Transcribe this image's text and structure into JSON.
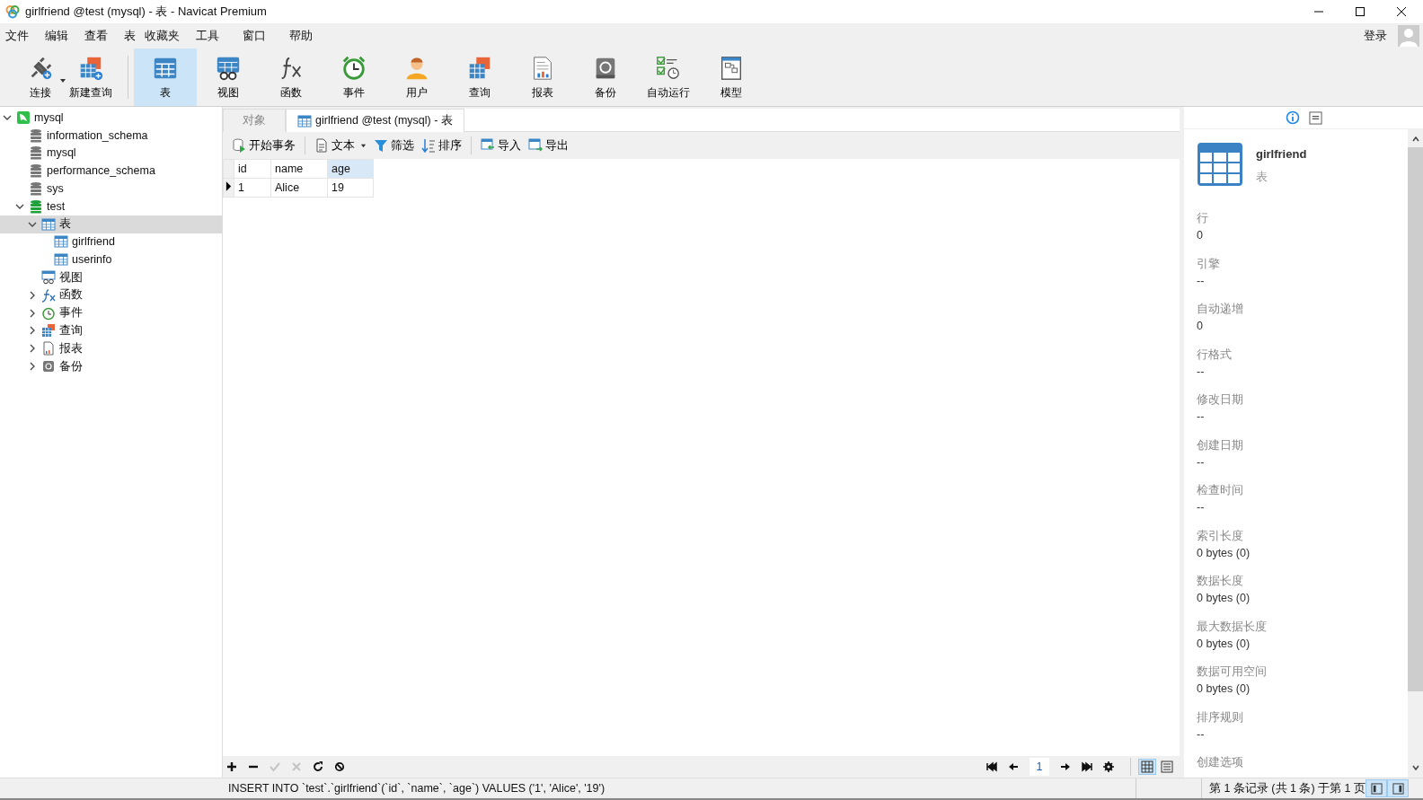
{
  "window": {
    "title": "girlfriend @test (mysql) - 表 - Navicat Premium"
  },
  "menu": [
    "文件",
    "编辑",
    "查看",
    "表",
    "收藏夹",
    "工具",
    "窗口",
    "帮助"
  ],
  "login": "登录",
  "toolbar": [
    {
      "kind": "connect",
      "label": "连接",
      "selected": false
    },
    {
      "kind": "new-query",
      "label": "新建查询",
      "selected": false
    },
    {
      "kind": "table",
      "label": "表",
      "selected": true
    },
    {
      "kind": "view",
      "label": "视图",
      "selected": false
    },
    {
      "kind": "function",
      "label": "函数",
      "selected": false
    },
    {
      "kind": "event",
      "label": "事件",
      "selected": false
    },
    {
      "kind": "user",
      "label": "用户",
      "selected": false
    },
    {
      "kind": "query",
      "label": "查询",
      "selected": false
    },
    {
      "kind": "report",
      "label": "报表",
      "selected": false
    },
    {
      "kind": "backup",
      "label": "备份",
      "selected": false
    },
    {
      "kind": "autorun",
      "label": "自动运行",
      "selected": false
    },
    {
      "kind": "model",
      "label": "模型",
      "selected": false
    }
  ],
  "tree": [
    {
      "kind": "server",
      "label": "mysql",
      "expanded": true,
      "selected": false,
      "children": [
        {
          "kind": "database",
          "label": "information_schema",
          "open": false,
          "selected": false
        },
        {
          "kind": "database",
          "label": "mysql",
          "open": false,
          "selected": false
        },
        {
          "kind": "database",
          "label": "performance_schema",
          "open": false,
          "selected": false
        },
        {
          "kind": "database",
          "label": "sys",
          "open": false,
          "selected": false
        },
        {
          "kind": "database",
          "label": "test",
          "open": true,
          "expanded": true,
          "selected": false,
          "children": [
            {
              "kind": "table",
              "label": "表",
              "expanded": true,
              "selected": true,
              "children": [
                {
                  "kind": "table",
                  "label": "girlfriend",
                  "selected": false
                },
                {
                  "kind": "table",
                  "label": "userinfo",
                  "selected": false
                }
              ]
            },
            {
              "kind": "view",
              "label": "视图",
              "selected": false
            },
            {
              "kind": "function",
              "label": "函数",
              "expanded": false,
              "selected": false
            },
            {
              "kind": "event",
              "label": "事件",
              "expanded": false,
              "selected": false
            },
            {
              "kind": "query",
              "label": "查询",
              "expanded": false,
              "selected": false
            },
            {
              "kind": "report",
              "label": "报表",
              "expanded": false,
              "selected": false
            },
            {
              "kind": "backup",
              "label": "备份",
              "expanded": false,
              "selected": false
            }
          ]
        }
      ]
    }
  ],
  "tabs": [
    {
      "kind": "objects",
      "label": "对象",
      "selected": false
    },
    {
      "kind": "table",
      "label": "girlfriend @test (mysql) - 表",
      "selected": true
    }
  ],
  "data_toolbar": [
    {
      "kind": "transaction",
      "label": "开始事务"
    },
    {
      "kind": "text",
      "label": "文本"
    },
    {
      "kind": "filter",
      "label": "筛选"
    },
    {
      "kind": "sort",
      "label": "排序"
    },
    {
      "kind": "import",
      "label": "导入"
    },
    {
      "kind": "export",
      "label": "导出"
    }
  ],
  "grid": {
    "columns": [
      {
        "label": "id",
        "selected": false
      },
      {
        "label": "name",
        "selected": false
      },
      {
        "label": "age",
        "selected": true
      }
    ],
    "rows": [
      {
        "current": true,
        "cells": [
          "1",
          "Alice",
          "19"
        ]
      }
    ]
  },
  "grid_actions": [
    {
      "kind": "add",
      "disabled": false
    },
    {
      "kind": "remove",
      "disabled": false
    },
    {
      "kind": "apply",
      "disabled": true
    },
    {
      "kind": "cancel",
      "disabled": true
    },
    {
      "kind": "refresh",
      "disabled": false
    },
    {
      "kind": "stop",
      "disabled": false
    }
  ],
  "pager": {
    "page": "1"
  },
  "view_modes": [
    {
      "kind": "grid",
      "selected": true
    },
    {
      "kind": "form",
      "selected": false
    }
  ],
  "info": {
    "name": "girlfriend",
    "type": "表",
    "properties": [
      {
        "label": "行",
        "value": "0"
      },
      {
        "label": "引擎",
        "value": "--"
      },
      {
        "label": "自动递增",
        "value": "0"
      },
      {
        "label": "行格式",
        "value": "--"
      },
      {
        "label": "修改日期",
        "value": "--"
      },
      {
        "label": "创建日期",
        "value": "--"
      },
      {
        "label": "检查时间",
        "value": "--"
      },
      {
        "label": "索引长度",
        "value": "0 bytes (0)"
      },
      {
        "label": "数据长度",
        "value": "0 bytes (0)"
      },
      {
        "label": "最大数据长度",
        "value": "0 bytes (0)"
      },
      {
        "label": "数据可用空间",
        "value": "0 bytes (0)"
      },
      {
        "label": "排序规则",
        "value": "--"
      },
      {
        "label": "创建选项"
      }
    ]
  },
  "status": {
    "sql": "INSERT INTO `test`.`girlfriend`(`id`, `name`, `age`) VALUES ('1', 'Alice', '19')",
    "records": "第 1 条记录 (共 1 条) 于第 1 页",
    "panels": [
      {
        "kind": "left",
        "selected": true
      },
      {
        "kind": "right",
        "selected": true
      }
    ]
  }
}
